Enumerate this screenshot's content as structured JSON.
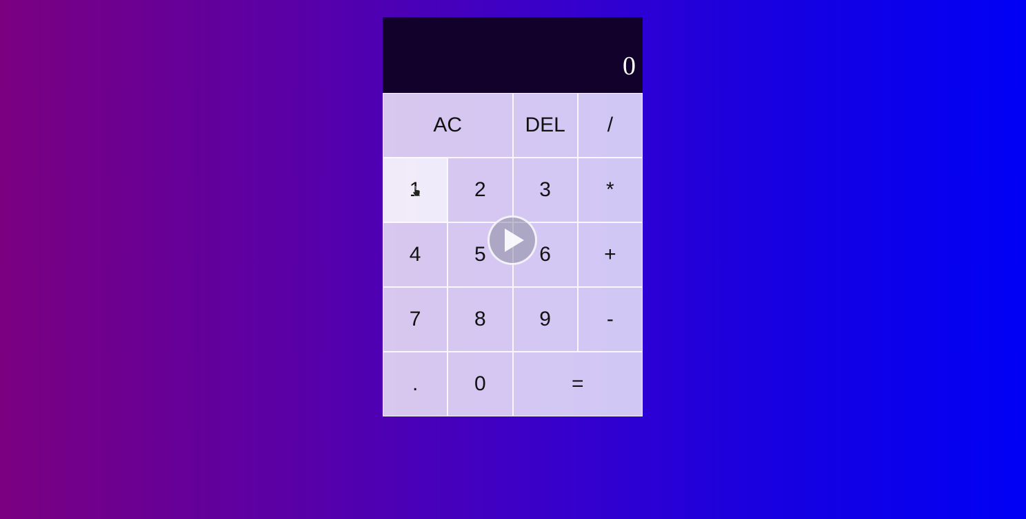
{
  "display": {
    "previous_operand": "",
    "current_operand": "0"
  },
  "keys": [
    {
      "label": "AC",
      "name": "all-clear-button",
      "span": 2
    },
    {
      "label": "DEL",
      "name": "delete-button",
      "span": 1
    },
    {
      "label": "/",
      "name": "divide-button",
      "span": 1
    },
    {
      "label": "1",
      "name": "digit-1-button",
      "span": 1,
      "hovered": true
    },
    {
      "label": "2",
      "name": "digit-2-button",
      "span": 1
    },
    {
      "label": "3",
      "name": "digit-3-button",
      "span": 1
    },
    {
      "label": "*",
      "name": "multiply-button",
      "span": 1
    },
    {
      "label": "4",
      "name": "digit-4-button",
      "span": 1
    },
    {
      "label": "5",
      "name": "digit-5-button",
      "span": 1
    },
    {
      "label": "6",
      "name": "digit-6-button",
      "span": 1
    },
    {
      "label": "+",
      "name": "add-button",
      "span": 1
    },
    {
      "label": "7",
      "name": "digit-7-button",
      "span": 1
    },
    {
      "label": "8",
      "name": "digit-8-button",
      "span": 1
    },
    {
      "label": "9",
      "name": "digit-9-button",
      "span": 1
    },
    {
      "label": "-",
      "name": "subtract-button",
      "span": 1
    },
    {
      "label": ".",
      "name": "decimal-button",
      "span": 1
    },
    {
      "label": "0",
      "name": "digit-0-button",
      "span": 1
    },
    {
      "label": "=",
      "name": "equals-button",
      "span": 2
    }
  ],
  "overlay": {
    "icon": "play-icon"
  },
  "colors": {
    "display_background": "#12012a",
    "key_background": "#d4c8ee",
    "gradient_start": "#7b0080",
    "gradient_end": "#0000f5"
  }
}
